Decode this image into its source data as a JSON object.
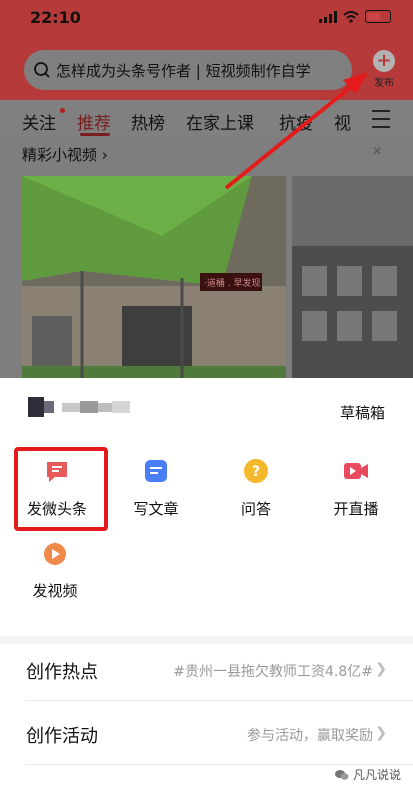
{
  "status": {
    "time": "22:10"
  },
  "search": {
    "text": "怎样成为头条号作者 | 短视频制作自学"
  },
  "publish": {
    "label": "发布",
    "icon": "plus-icon"
  },
  "tabs": [
    "关注",
    "推荐",
    "热榜",
    "在家上课",
    "抗疫",
    "视"
  ],
  "active_tab": "推荐",
  "feed": {
    "title": "精彩小视频 ›",
    "sign_text": "·道桶 . 早发现"
  },
  "sheet": {
    "drafts": "草稿箱",
    "actions": [
      {
        "label": "发微头条",
        "icon": "micro-headline-icon",
        "color": "#e85a5a"
      },
      {
        "label": "写文章",
        "icon": "article-icon",
        "color": "#4a7ef5"
      },
      {
        "label": "问答",
        "icon": "qa-icon",
        "color": "#f5b82a"
      },
      {
        "label": "开直播",
        "icon": "live-icon",
        "color": "#e84a5f"
      },
      {
        "label": "发视频",
        "icon": "video-icon",
        "color": "#f08a4b"
      }
    ]
  },
  "list": [
    {
      "label": "创作热点",
      "value": "#贵州一县拖欠教师工资4.8亿#"
    },
    {
      "label": "创作活动",
      "value": "参与活动，赢取奖励"
    }
  ],
  "watermark": "凡凡说说",
  "colors": {
    "highlight_box": "#e51b1b",
    "arrow": "#e51b1b",
    "accent": "#e62b2b"
  }
}
